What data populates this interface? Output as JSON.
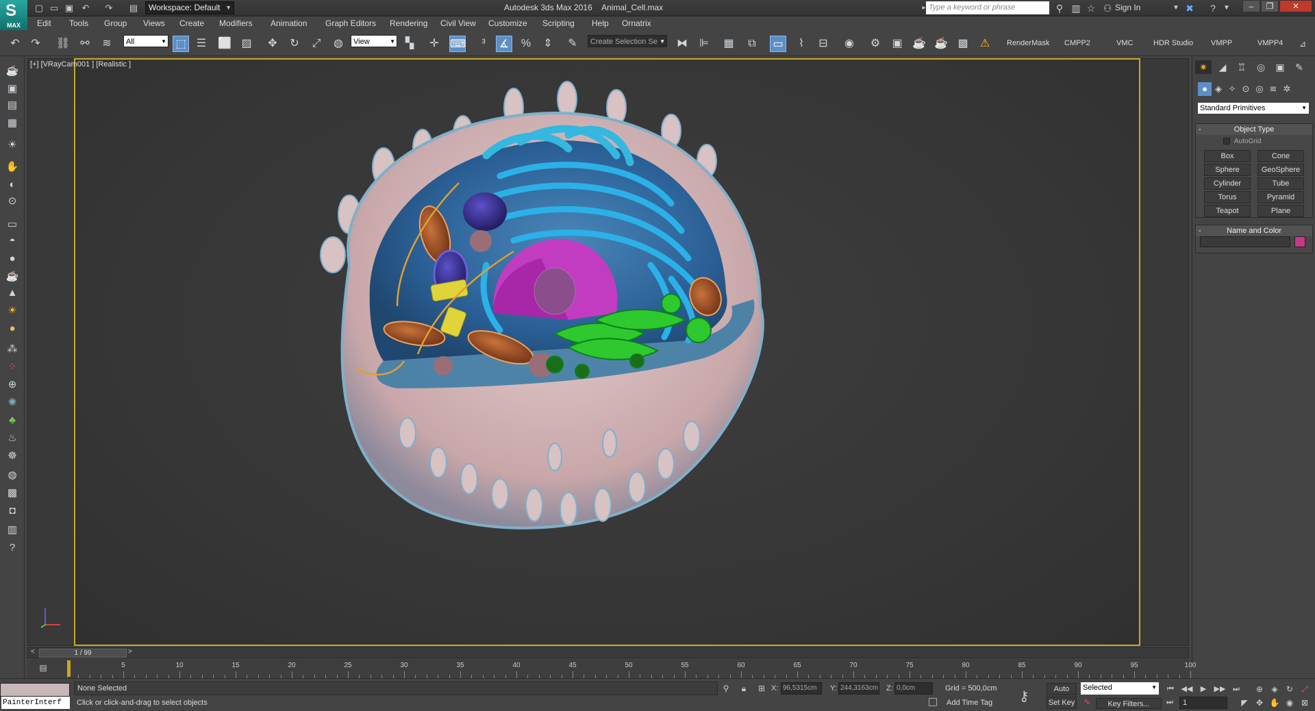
{
  "titlebar": {
    "workspace": "Workspace: Default",
    "app_name": "Autodesk 3ds Max 2016",
    "file_name": "Animal_Cell.max",
    "search_placeholder": "Type a keyword or phrase",
    "sign_in": "Sign In"
  },
  "logo_text": "MAX",
  "menu": [
    "Edit",
    "Tools",
    "Group",
    "Views",
    "Create",
    "Modifiers",
    "Animation",
    "Graph Editors",
    "Rendering",
    "Civil View",
    "Customize",
    "Scripting",
    "Help",
    "Ornatrix"
  ],
  "toolbar": {
    "selection_filter": "All",
    "ref_coord": "View",
    "named_selection_placeholder": "Create Selection Se",
    "plugins": [
      "RenderMask",
      "CMPP2",
      "VMC",
      "HDR Studio",
      "VMPP",
      "VMPP4"
    ]
  },
  "viewport": {
    "label": "[+] [VRayCam001 ] [Realistic ]"
  },
  "command_panel": {
    "category": "Standard Primitives",
    "object_type_title": "Object Type",
    "autogrid_label": "AutoGrid",
    "object_buttons": [
      "Box",
      "Cone",
      "Sphere",
      "GeoSphere",
      "Cylinder",
      "Tube",
      "Torus",
      "Pyramid",
      "Teapot",
      "Plane"
    ],
    "name_color_title": "Name and Color",
    "object_color": "#c8388a"
  },
  "timeslider": {
    "frame_label": "1 / 99",
    "ticks": [
      5,
      10,
      15,
      20,
      25,
      30,
      35,
      40,
      45,
      50,
      55,
      60,
      65,
      70,
      75,
      80,
      85,
      90,
      95,
      100
    ]
  },
  "status": {
    "painter_label": "PainterInterf",
    "selection": "None Selected",
    "prompt": "Click or click-and-drag to select objects",
    "x_label": "X:",
    "x_value": "96,5315cm",
    "y_label": "Y:",
    "y_value": "244,3163cm",
    "z_label": "Z:",
    "z_value": "0,0cm",
    "grid": "Grid = 500,0cm",
    "add_time_tag": "Add Time Tag",
    "auto_key": "Auto Key",
    "set_key": "Set Key",
    "selected_set": "Selected",
    "key_filters": "Key Filters...",
    "current_frame": "1"
  },
  "colors": {
    "viewport_border": "#c8a928",
    "active_button": "#5d8fc7"
  }
}
